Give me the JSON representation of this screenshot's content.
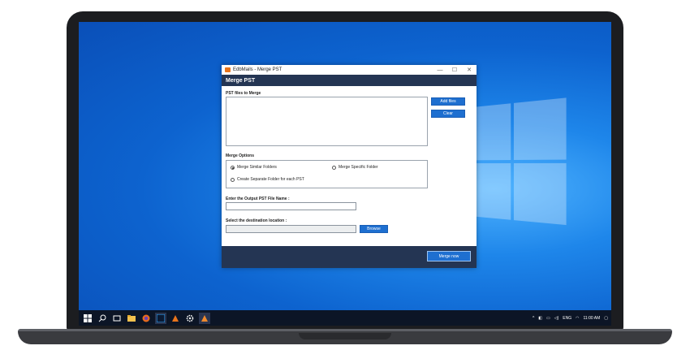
{
  "window": {
    "title": "EdbMails - Merge PST",
    "minimize": "—",
    "maximize": "☐",
    "close": "✕"
  },
  "header": {
    "title": "Merge PST"
  },
  "files": {
    "label": "PST files to Merge",
    "add_button": "Add files",
    "clear_button": "Clear"
  },
  "options": {
    "label": "Merge Options",
    "similar": "Merge Similar Folders",
    "specific": "Merge Specific Folder",
    "separate": "Create Separate Folder for each PST",
    "selected": "similar"
  },
  "output": {
    "label": "Enter the Output PST File Name :",
    "value": ""
  },
  "destination": {
    "label": "Select the destination location :",
    "value": "",
    "browse_button": "Browse"
  },
  "footer": {
    "merge_button": "Merge now"
  },
  "taskbar": {
    "language": "ENG",
    "time": "11:00 AM"
  }
}
